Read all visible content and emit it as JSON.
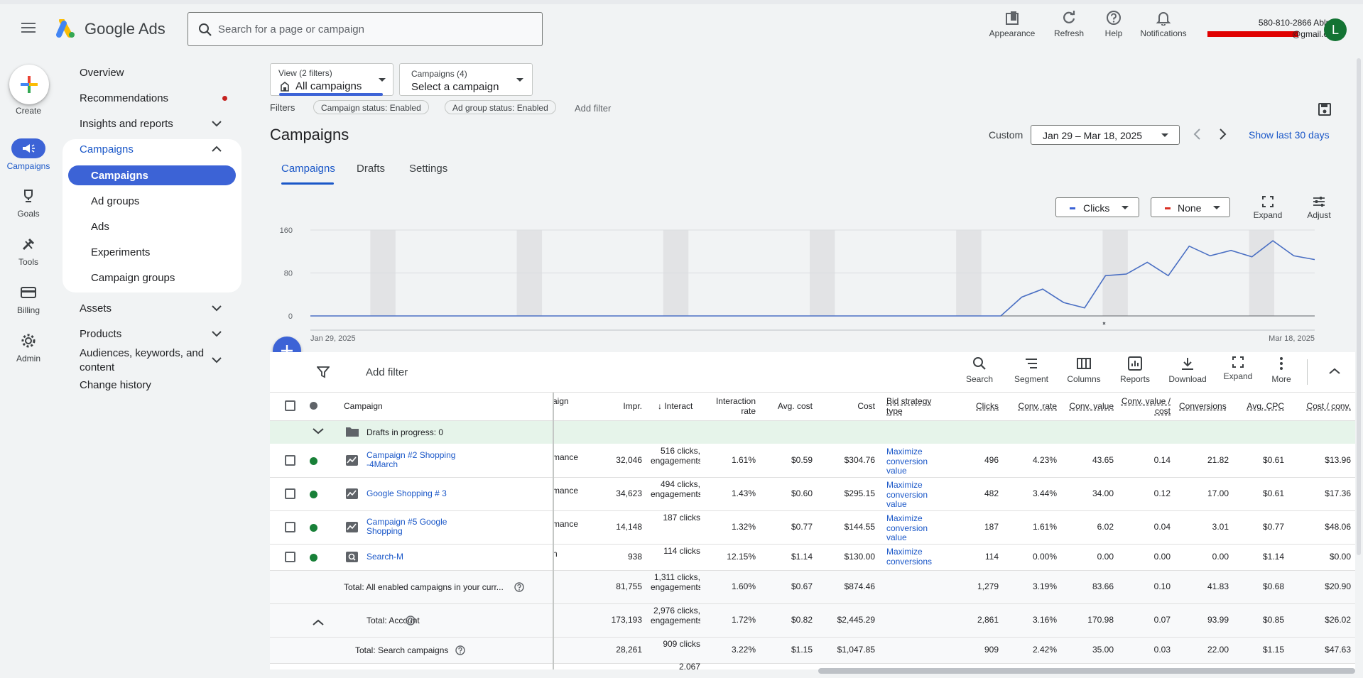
{
  "header": {
    "app_name": "Google Ads",
    "search_placeholder": "Search for a page or campaign",
    "account_phone": "580-810-2866 Ablnco",
    "account_email": "@gmail.com",
    "avatar_letter": "L",
    "toolbar": [
      {
        "label": "Appearance",
        "icon": "appearance-icon"
      },
      {
        "label": "Refresh",
        "icon": "refresh-icon"
      },
      {
        "label": "Help",
        "icon": "help-icon"
      },
      {
        "label": "Notifications",
        "icon": "bell-icon"
      }
    ]
  },
  "rail": {
    "create": "Create",
    "items": [
      "Campaigns",
      "Goals",
      "Tools",
      "Billing",
      "Admin"
    ]
  },
  "nav": {
    "overview": "Overview",
    "recommendations": "Recommendations",
    "insights": "Insights and reports",
    "campaigns": "Campaigns",
    "sub": [
      "Campaigns",
      "Ad groups",
      "Ads",
      "Experiments",
      "Campaign groups"
    ],
    "assets": "Assets",
    "products": "Products",
    "audiences": "Audiences, keywords, and content",
    "change_history": "Change history"
  },
  "filters": {
    "view_top": "View (2 filters)",
    "view_main": "All campaigns",
    "campaigns_top": "Campaigns (4)",
    "campaigns_main": "Select a campaign",
    "label": "Filters",
    "chips": [
      "Campaign status: Enabled",
      "Ad group status: Enabled"
    ],
    "add": "Add filter"
  },
  "page": {
    "title": "Campaigns",
    "date_label": "Custom",
    "date_range": "Jan 29 – Mar 18, 2025",
    "show_last": "Show last 30 days",
    "tabs": [
      "Campaigns",
      "Drafts",
      "Settings"
    ]
  },
  "chart_ui": {
    "metric1": "Clicks",
    "metric2": "None",
    "expand": "Expand",
    "adjust": "Adjust"
  },
  "chart_data": {
    "type": "line",
    "series": [
      {
        "name": "Clicks",
        "values": [
          0,
          0,
          0,
          0,
          0,
          0,
          0,
          0,
          0,
          0,
          0,
          0,
          0,
          0,
          0,
          0,
          0,
          0,
          0,
          0,
          0,
          0,
          0,
          0,
          0,
          0,
          0,
          0,
          0,
          0,
          0,
          0,
          0,
          0,
          35,
          50,
          25,
          15,
          75,
          78,
          100,
          75,
          130,
          112,
          122,
          110,
          140,
          112,
          105
        ]
      }
    ],
    "x_start": "Jan 29, 2025",
    "x_end": "Mar 18, 2025",
    "y_ticks": [
      0,
      80,
      160
    ],
    "ylim": [
      0,
      160
    ],
    "color": "#4a6fc3"
  },
  "table_actions": {
    "add_filter": "Add filter",
    "items": [
      "Search",
      "Segment",
      "Columns",
      "Reports",
      "Download",
      "Expand",
      "More"
    ]
  },
  "columns": {
    "campaign": "Campaign",
    "type_frag": "aign",
    "impr": "Impr.",
    "interactions": "Interact",
    "interaction_rate": "Interaction rate",
    "avg_cost": "Avg. cost",
    "cost": "Cost",
    "bid": "Bid strategy type",
    "clicks": "Clicks",
    "conv_rate": "Conv. rate",
    "conv_value": "Conv. value",
    "conv_value_cost": "Conv. value / cost",
    "conversions": "Conversions",
    "avg_cpc": "Avg. CPC",
    "cost_conv": "Cost / conv."
  },
  "drafts": "Drafts in progress: 0",
  "rows": [
    {
      "name": "Campaign #2 Shopping -4March",
      "type": "mance",
      "impr": "32,046",
      "inter": "516 clicks, engagements",
      "rate": "1.61%",
      "avg": "$0.59",
      "cost": "$304.76",
      "bid": "Maximize conversion value",
      "clicks": "496",
      "cr": "4.23%",
      "cv": "43.65",
      "cvc": "0.14",
      "conv": "21.82",
      "cpc": "$0.61",
      "cpa": "$13.96"
    },
    {
      "name": "Google Shopping # 3",
      "type": "mance",
      "impr": "34,623",
      "inter": "494 clicks, engagements",
      "rate": "1.43%",
      "avg": "$0.60",
      "cost": "$295.15",
      "bid": "Maximize conversion value",
      "clicks": "482",
      "cr": "3.44%",
      "cv": "34.00",
      "cvc": "0.12",
      "conv": "17.00",
      "cpc": "$0.61",
      "cpa": "$17.36"
    },
    {
      "name": "Campaign #5 Google Shopping",
      "type": "mance",
      "impr": "14,148",
      "inter": "187 clicks",
      "rate": "1.32%",
      "avg": "$0.77",
      "cost": "$144.55",
      "bid": "Maximize conversion value",
      "clicks": "187",
      "cr": "1.61%",
      "cv": "6.02",
      "cvc": "0.04",
      "conv": "3.01",
      "cpc": "$0.77",
      "cpa": "$48.06"
    },
    {
      "name": "Search-M",
      "type": "n",
      "impr": "938",
      "inter": "114 clicks",
      "rate": "12.15%",
      "avg": "$1.14",
      "cost": "$130.00",
      "bid": "Maximize conversions",
      "clicks": "114",
      "cr": "0.00%",
      "cv": "0.00",
      "cvc": "0.00",
      "conv": "0.00",
      "cpc": "$1.14",
      "cpa": "$0.00"
    }
  ],
  "totals": [
    {
      "name": "Total: All enabled campaigns in your curr...",
      "impr": "81,755",
      "inter": "1,311 clicks, engagements",
      "rate": "1.60%",
      "avg": "$0.67",
      "cost": "$874.46",
      "clicks": "1,279",
      "cr": "3.19%",
      "cv": "83.66",
      "cvc": "0.10",
      "conv": "41.83",
      "cpc": "$0.68",
      "cpa": "$20.90"
    },
    {
      "name": "Total: Account",
      "impr": "173,193",
      "inter": "2,976 clicks, engagements",
      "rate": "1.72%",
      "avg": "$0.82",
      "cost": "$2,445.29",
      "clicks": "2,861",
      "cr": "3.16%",
      "cv": "170.98",
      "cvc": "0.07",
      "conv": "93.99",
      "cpc": "$0.85",
      "cpa": "$26.02"
    },
    {
      "name": "Total: Search campaigns",
      "impr": "28,261",
      "inter": "909 clicks",
      "rate": "3.22%",
      "avg": "$1.15",
      "cost": "$1,047.85",
      "clicks": "909",
      "cr": "2.42%",
      "cv": "35.00",
      "cvc": "0.03",
      "conv": "22.00",
      "cpc": "$1.15",
      "cpa": "$47.63"
    }
  ],
  "partial_row": "2,067"
}
